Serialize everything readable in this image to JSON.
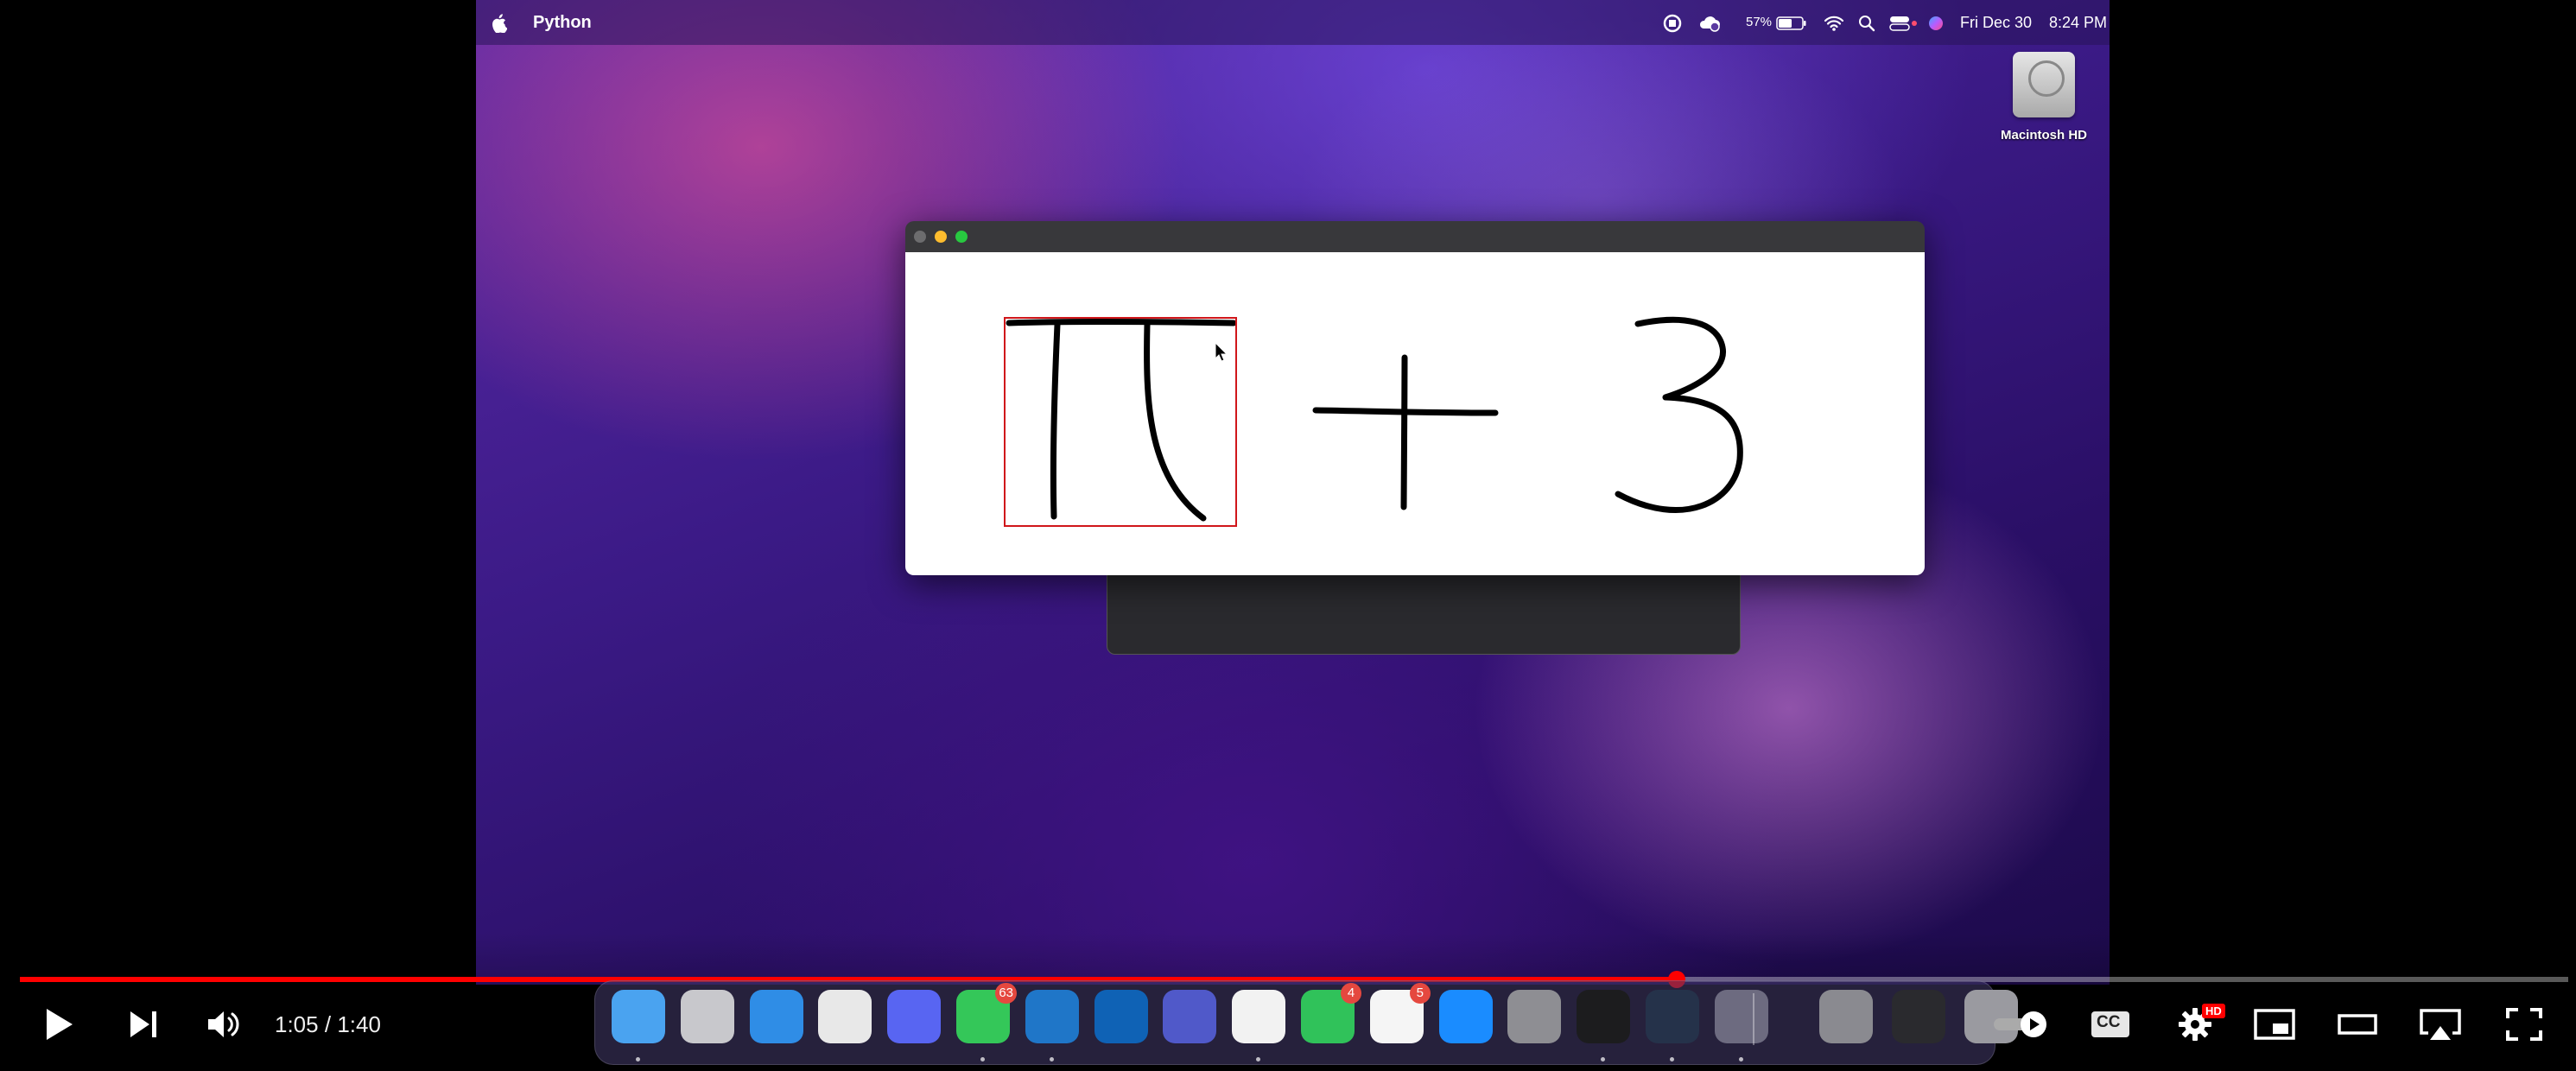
{
  "menubar": {
    "app_name": "Python",
    "battery_percent": "57%",
    "date": "Fri Dec 30",
    "time": "8:24 PM",
    "icons": [
      "apple-icon",
      "screen-record-icon",
      "cloud-icon",
      "battery-icon",
      "wifi-icon",
      "search-icon",
      "control-center-icon",
      "siri-icon"
    ]
  },
  "desktop": {
    "drive_label": "Macintosh HD"
  },
  "drawing_window": {
    "strokes_description_ids": [
      "pi",
      "plus",
      "three"
    ],
    "highlight_color": "#d0161a"
  },
  "dock": {
    "apps": [
      {
        "name": "finder",
        "badge": ""
      },
      {
        "name": "launchpad",
        "badge": ""
      },
      {
        "name": "safari",
        "badge": ""
      },
      {
        "name": "chrome",
        "badge": ""
      },
      {
        "name": "discord",
        "badge": ""
      },
      {
        "name": "messages",
        "badge": "63"
      },
      {
        "name": "vscode",
        "badge": ""
      },
      {
        "name": "outlook",
        "badge": ""
      },
      {
        "name": "teams",
        "badge": ""
      },
      {
        "name": "notion",
        "badge": ""
      },
      {
        "name": "facetime",
        "badge": "4"
      },
      {
        "name": "reminders",
        "badge": "5"
      },
      {
        "name": "app-store",
        "badge": ""
      },
      {
        "name": "system-preferences",
        "badge": ""
      },
      {
        "name": "terminal",
        "badge": ""
      },
      {
        "name": "quicktime",
        "badge": ""
      },
      {
        "name": "python-launcher",
        "badge": ""
      },
      {
        "name": "downloads-stack",
        "badge": ""
      },
      {
        "name": "documents-stack",
        "badge": ""
      },
      {
        "name": "trash",
        "badge": ""
      }
    ]
  },
  "player": {
    "current_time": "1:05",
    "separator": "/",
    "duration": "1:40",
    "progress_fraction": 0.65,
    "hd_badge": "HD",
    "cc_label": "CC",
    "autoplay_on": true,
    "accent_color": "#ff0000"
  }
}
